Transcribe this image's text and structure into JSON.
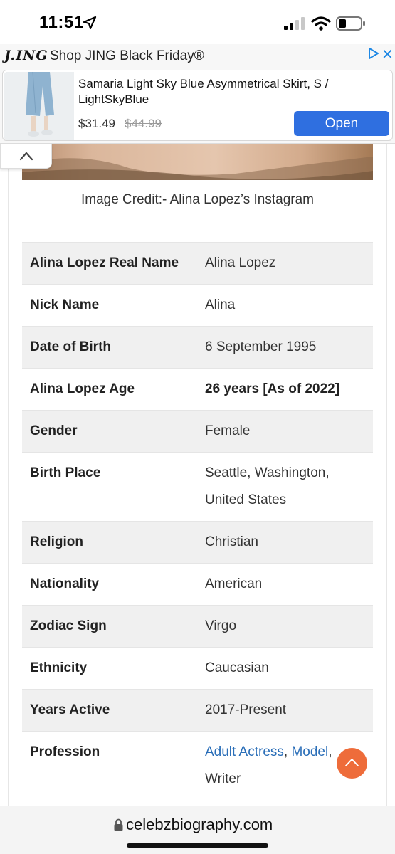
{
  "status_bar": {
    "time": "11:51"
  },
  "ad": {
    "logo": "J.ING",
    "header": "Shop JING Black Friday®",
    "product_title": "Samaria Light Sky Blue Asymmetrical Skirt, S / LightSkyBlue",
    "price": "$31.49",
    "old_price": "$44.99",
    "button_label": "Open",
    "close_label": "✕"
  },
  "article": {
    "image_credit": "Image Credit:- Alina Lopez’s Instagram",
    "rows": [
      {
        "label": "Alina Lopez Real Name",
        "value": "Alina Lopez"
      },
      {
        "label": "Nick Name",
        "value": "Alina"
      },
      {
        "label": "Date of Birth",
        "value": "6 September 1995"
      },
      {
        "label": "Alina Lopez Age",
        "value": "26 years [As of 2022]"
      },
      {
        "label": "Gender",
        "value": "Female"
      },
      {
        "label": "Birth Place",
        "value": "Seattle, Washington, United States"
      },
      {
        "label": "Religion",
        "value": "Christian"
      },
      {
        "label": "Nationality",
        "value": "American"
      },
      {
        "label": "Zodiac Sign",
        "value": "Virgo"
      },
      {
        "label": "Ethnicity",
        "value": "Caucasian"
      },
      {
        "label": "Years Active",
        "value": "2017-Present"
      },
      {
        "label": "Profession",
        "link1": "Adult Actress",
        "separator": ", ",
        "link2": "Model",
        "trailing": ", Writer"
      }
    ]
  },
  "browser": {
    "url": "celebzbiography.com"
  },
  "colors": {
    "accent_button": "#2f6fe0",
    "scroll_top": "#ee6c3a",
    "link": "#2a6eb8"
  }
}
